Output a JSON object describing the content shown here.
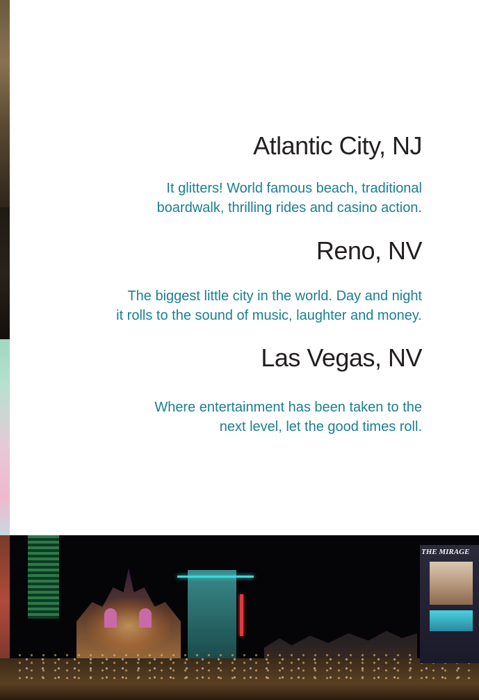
{
  "cities": [
    {
      "name": "Atlantic City, NJ",
      "description_lines": [
        "It glitters! World famous beach, traditional",
        "boardwalk, thrilling rides and casino action."
      ]
    },
    {
      "name": "Reno, NV",
      "description_lines": [
        "The biggest little city in the world.  Day and night",
        "it rolls to the sound of music, laughter and money."
      ]
    },
    {
      "name": "Las Vegas, NV",
      "description_lines": [
        "Where entertainment has been taken to the",
        "next level, let the good times roll."
      ]
    }
  ],
  "photo": {
    "sign_text": "THE MIRAGE"
  },
  "colors": {
    "heading": "#231f20",
    "description": "#1a7f92",
    "background": "#ffffff"
  }
}
